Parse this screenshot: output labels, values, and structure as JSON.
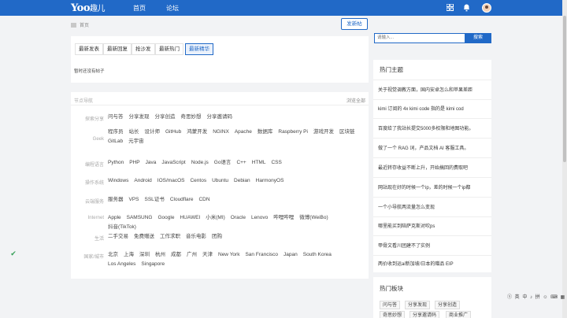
{
  "header": {
    "logo": "Yoo",
    "logo_suffix": "趣儿",
    "nav": [
      "首页",
      "论坛"
    ],
    "icons": [
      "grid-icon",
      "bell-icon",
      "avatar"
    ]
  },
  "breadcrumb": {
    "current": "首页"
  },
  "post_button": "发新帖",
  "tabs": [
    "最新发表",
    "最新回复",
    "抢沙发",
    "最新热门",
    "最新精华"
  ],
  "active_tab": "最新精华",
  "empty_text": "暂时还没有帖子",
  "nodes": {
    "title": "节点导航",
    "view_all": "浏览全部",
    "rows": [
      {
        "category": "探索分享",
        "links": [
          "问与答",
          "分享发现",
          "分享创造",
          "奇思妙想",
          "分享邀请码"
        ]
      },
      {
        "category": "Geek",
        "links": [
          "程序员",
          "站长",
          "设计师",
          "GitHub",
          "鸿蒙开发",
          "NGINX",
          "Apache",
          "数据库",
          "Raspberry Pi",
          "游戏开发",
          "区块链",
          "GitLab",
          "元宇宙"
        ]
      },
      {
        "category": "编程语言",
        "links": [
          "Python",
          "PHP",
          "Java",
          "JavaScript",
          "Node.js",
          "Go语言",
          "C++",
          "HTML",
          "CSS"
        ]
      },
      {
        "category": "操作系统",
        "links": [
          "Windows",
          "Android",
          "IOS/macOS",
          "Centos",
          "Ubuntu",
          "Debian",
          "HarmonyOS"
        ]
      },
      {
        "category": "云端服务",
        "links": [
          "服务器",
          "VPS",
          "SSL证书",
          "Cloudflare",
          "CDN"
        ]
      },
      {
        "category": "Internet",
        "links": [
          "Apple",
          "SAMSUNG",
          "Google",
          "HUAWEI",
          "小米(MI)",
          "Oracle",
          "Lenovo",
          "哔哩哔哩",
          "微博(WeiBo)",
          "抖音(TikTok)"
        ]
      },
      {
        "category": "生活",
        "links": [
          "二手交易",
          "免费赠送",
          "工作求职",
          "音乐电影",
          "团购"
        ]
      },
      {
        "category": "国家/城市",
        "links": [
          "北京",
          "上海",
          "深圳",
          "杭州",
          "成都",
          "广州",
          "天津",
          "New York",
          "San Francisco",
          "Japan",
          "South Korea",
          "Los Angeles",
          "Singapore"
        ]
      }
    ]
  },
  "search": {
    "placeholder": "请输入...",
    "button": "搜索"
  },
  "hot_topics": {
    "title": "热门主题",
    "items": [
      "关于视觉调教方面，国内安卓怎么和苹果差距",
      "kimi 订阅的 4x kimi code 指的是 kimi cod",
      "百度给了我站长提交5000多权限和地图功能。",
      "做了一个 RAG 词，产品文档 AI 客服工具。",
      "最近转存收益不断上升，开始搞回的费取吧",
      "网站现在好的时候一个ip，差的时候一个ip都",
      "一个小导航两流量怎么变现",
      "哪里能买到陪萨克斯对吹ps",
      "甲骨文看川团建不了实例",
      "两价收到运ai新加坡/日本的赠品 EIP"
    ]
  },
  "hot_boards": {
    "title": "热门板块",
    "chips": [
      "问与答",
      "分享发现",
      "分享创造",
      "奇思妙想",
      "分享邀请码",
      "商业推广"
    ]
  },
  "ime_bar": "ⓢ 英 中 ♪ 拼 ☺ ⌨ ▦"
}
